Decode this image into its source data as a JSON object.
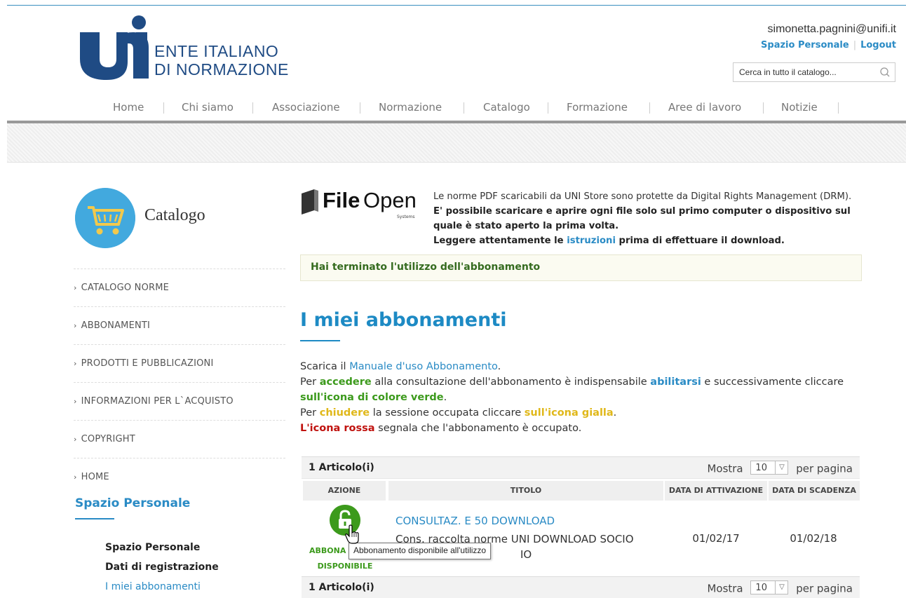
{
  "header": {
    "logo_line1": "ENTE ITALIANO",
    "logo_line2": "DI NORMAZIONE",
    "user_email": "simonetta.pagnini@unifi.it",
    "personal_link": "Spazio Personale",
    "logout_link": "Logout",
    "search_placeholder": "Cerca in tutto il catalogo..."
  },
  "nav": [
    "Home",
    "Chi siamo",
    "Associazione",
    "Normazione",
    "Catalogo",
    "Formazione",
    "Aree di lavoro",
    "Notizie"
  ],
  "sidebar": {
    "title": "Catalogo",
    "menu": [
      "CATALOGO NORME",
      "ABBONAMENTI",
      "PRODOTTI E PUBBLICAZIONI",
      "INFORMAZIONI PER L`ACQUISTO",
      "COPYRIGHT",
      "HOME"
    ],
    "personal_title": "Spazio Personale",
    "personal_links": [
      "Spazio Personale",
      "Dati di registrazione",
      "I miei abbonamenti"
    ]
  },
  "fileopen": {
    "brand_bold": "File",
    "brand_light": "Open",
    "brand_sub": "Systems",
    "line1": "Le norme PDF scaricabili da UNI Store sono protette da Digital Rights Management (DRM).",
    "line2": "E' possibile scaricare e aprire ogni file solo sul primo computer o dispositivo sul quale è stato aperto la prima volta.",
    "line3_a": "Leggere attentamente le ",
    "line3_link": "istruzioni",
    "line3_b": " prima di effettuare il download."
  },
  "notice": "Hai terminato l'utilizzo dell'abbonamento",
  "page_title": "I miei abbonamenti",
  "instructions": {
    "l1_a": "Scarica il ",
    "l1_link": "Manuale d'uso Abbonamento",
    "l1_b": ".",
    "l2_a": "Per ",
    "l2_green": "accedere",
    "l2_b": " alla consultazione dell'abbonamento è indispensabile ",
    "l2_blue": "abilitarsi",
    "l2_c": " e successivamente cliccare ",
    "l2_green2": "sull'icona di colore verde",
    "l2_d": ".",
    "l3_a": "Per ",
    "l3_yellow": "chiudere",
    "l3_b": " la sessione occupata cliccare ",
    "l3_yellow2": "sull'icona gialla",
    "l3_c": ".",
    "l4_red": "L'icona rossa",
    "l4_b": " segnala che l'abbonamento è occupato."
  },
  "pager": {
    "count": "1 Articolo(i)",
    "show": "Mostra",
    "per_page_value": "10",
    "per_page": "per pagina"
  },
  "table": {
    "headers": [
      "AZIONE",
      "TITOLO",
      "DATA DI ATTIVAZIONE",
      "DATA DI SCADENZA"
    ],
    "rows": [
      {
        "action_label_1": "ABBONA",
        "action_label_2": "DISPONIBILE",
        "title": "CONSULTAZ. E 50 DOWNLOAD",
        "subtitle_1": "Cons. raccolta norme UNI DOWNLOAD SOCIO",
        "subtitle_2": "IO",
        "activation": "01/02/17",
        "expiry": "01/02/18"
      }
    ]
  },
  "tooltip": "Abbonamento disponibile all'utilizzo",
  "colors": {
    "accent_blue": "#2a8bc5",
    "green": "#3c9a1c",
    "yellow": "#e0b81a",
    "red": "#c0130f",
    "logo_blue": "#1f4b84"
  }
}
